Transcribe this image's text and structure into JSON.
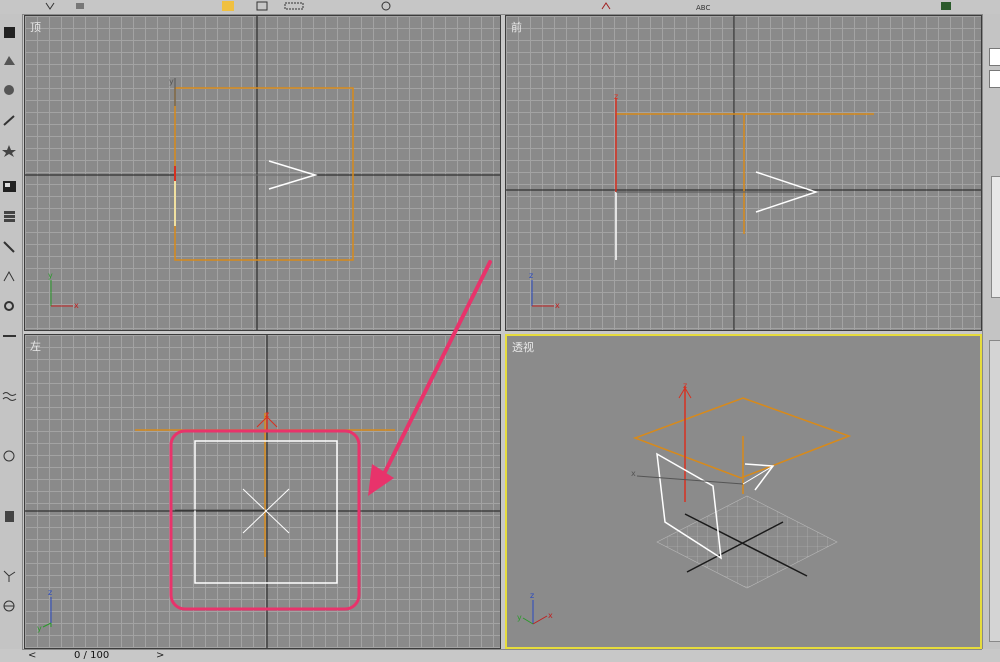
{
  "viewports": {
    "top": {
      "label": "顶"
    },
    "front": {
      "label": "前"
    },
    "left": {
      "label": "左"
    },
    "perspective": {
      "label": "透视"
    }
  },
  "axes": {
    "x": "x",
    "y": "y",
    "z": "z"
  },
  "timeline": {
    "frame_readout": "0 / 100",
    "prev_arrow": "<",
    "next_arrow": ">"
  },
  "colors": {
    "viewport_bg": "#8a8a8a",
    "grid_line": "#a3a3a3",
    "active_border": "#e6dc3c",
    "object_orange": "#d88a1a",
    "annotation_pink": "#e8336b"
  },
  "icons": [
    "select-arrow-icon",
    "select-by-name-icon",
    "rect-region-icon",
    "move-icon",
    "create-icon",
    "modify-icon",
    "hierarchy-icon",
    "motion-icon",
    "display-icon",
    "utilities-icon"
  ]
}
